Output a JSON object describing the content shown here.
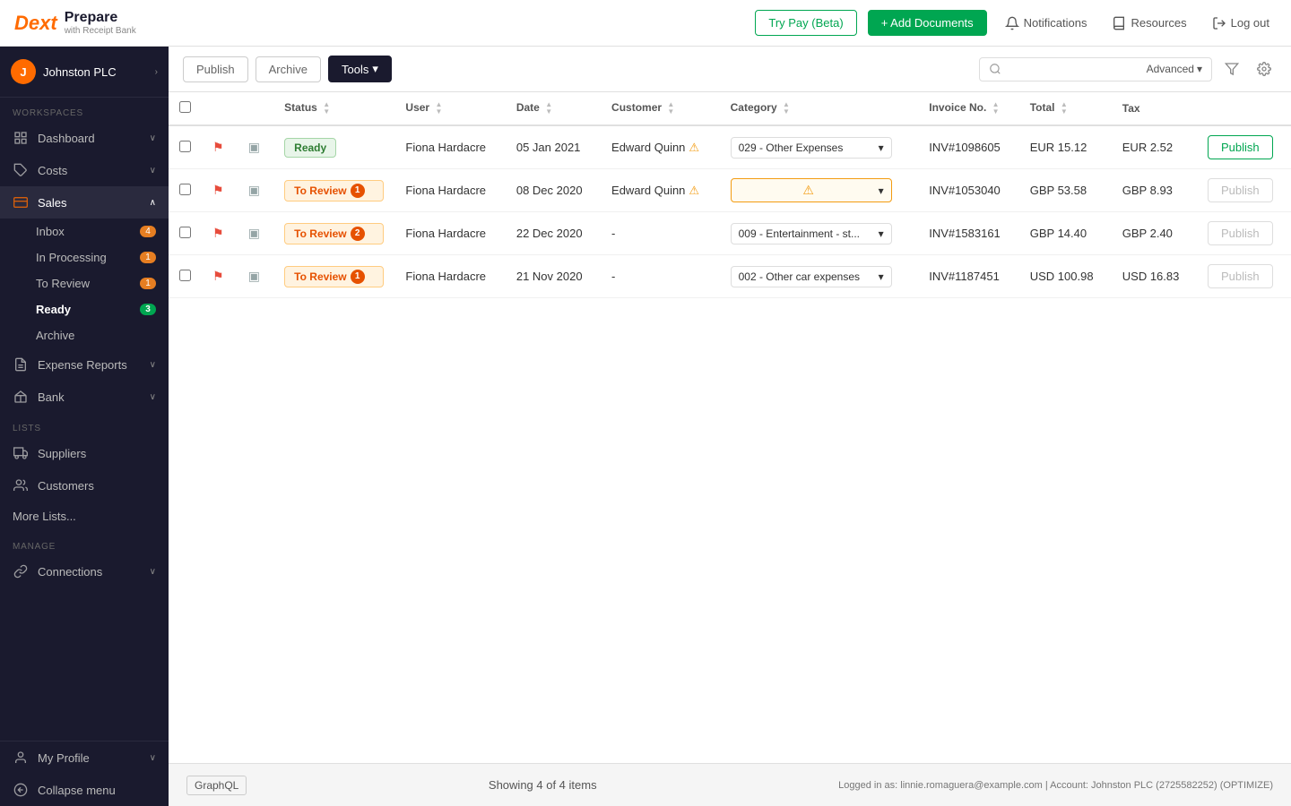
{
  "topbar": {
    "logo": "Dext",
    "product": "Prepare",
    "subtitle": "with Receipt Bank",
    "try_pay_label": "Try Pay (Beta)",
    "add_docs_label": "+ Add Documents",
    "notifications_label": "Notifications",
    "resources_label": "Resources",
    "logout_label": "Log out"
  },
  "sidebar": {
    "user": {
      "initials": "J",
      "name": "Johnston PLC"
    },
    "workspaces_label": "WORKSPACES",
    "items": [
      {
        "id": "dashboard",
        "label": "Dashboard",
        "icon": "grid"
      },
      {
        "id": "costs",
        "label": "Costs",
        "icon": "tag",
        "has_arrow": true
      },
      {
        "id": "sales",
        "label": "Sales",
        "icon": "credit-card",
        "has_arrow": true,
        "expanded": true
      },
      {
        "id": "expense-reports",
        "label": "Expense Reports",
        "icon": "file-text",
        "has_arrow": true
      },
      {
        "id": "bank",
        "label": "Bank",
        "icon": "bank",
        "has_arrow": true
      }
    ],
    "sales_sub": [
      {
        "id": "inbox",
        "label": "Inbox",
        "badge": "4"
      },
      {
        "id": "in-processing",
        "label": "In Processing",
        "badge": "1"
      },
      {
        "id": "to-review",
        "label": "To Review",
        "badge": "1"
      },
      {
        "id": "ready",
        "label": "Ready",
        "badge": "3"
      },
      {
        "id": "archive",
        "label": "Archive",
        "badge": ""
      }
    ],
    "lists_label": "LISTS",
    "list_items": [
      {
        "id": "suppliers",
        "label": "Suppliers",
        "icon": "truck"
      },
      {
        "id": "customers",
        "label": "Customers",
        "icon": "users"
      },
      {
        "id": "more-lists",
        "label": "More Lists...",
        "icon": ""
      }
    ],
    "manage_label": "MANAGE",
    "manage_items": [
      {
        "id": "connections",
        "label": "Connections",
        "icon": "link",
        "has_arrow": true
      },
      {
        "id": "my-profile",
        "label": "My Profile",
        "icon": "user",
        "has_arrow": true
      }
    ],
    "collapse_label": "Collapse menu"
  },
  "toolbar": {
    "publish_label": "Publish",
    "archive_label": "Archive",
    "tools_label": "Tools",
    "search_placeholder": "",
    "advanced_label": "Advanced"
  },
  "table": {
    "columns": [
      {
        "id": "status",
        "label": "Status"
      },
      {
        "id": "user",
        "label": "User"
      },
      {
        "id": "date",
        "label": "Date"
      },
      {
        "id": "customer",
        "label": "Customer"
      },
      {
        "id": "category",
        "label": "Category"
      },
      {
        "id": "invoice_no",
        "label": "Invoice No."
      },
      {
        "id": "total",
        "label": "Total"
      },
      {
        "id": "tax",
        "label": "Tax"
      }
    ],
    "rows": [
      {
        "id": "row1",
        "status": "Ready",
        "status_type": "ready",
        "user": "Fiona Hardacre",
        "date": "05 Jan 2021",
        "customer": "Edward Quinn",
        "customer_warn": true,
        "category": "029 - Other Expenses",
        "category_warn": false,
        "invoice_no": "INV#1098605",
        "total": "EUR 15.12",
        "tax": "EUR 2.52",
        "can_publish": true
      },
      {
        "id": "row2",
        "status": "To Review",
        "status_type": "review",
        "status_num": "1",
        "user": "Fiona Hardacre",
        "date": "08 Dec 2020",
        "customer": "Edward Quinn",
        "customer_warn": true,
        "category": "",
        "category_warn": true,
        "invoice_no": "INV#1053040",
        "total": "GBP 53.58",
        "tax": "GBP 8.93",
        "can_publish": false
      },
      {
        "id": "row3",
        "status": "To Review",
        "status_type": "review",
        "status_num": "2",
        "user": "Fiona Hardacre",
        "date": "22 Dec 2020",
        "customer": "-",
        "customer_warn": false,
        "category": "009 - Entertainment - st...",
        "category_warn": false,
        "invoice_no": "INV#1583161",
        "total": "GBP 14.40",
        "tax": "GBP 2.40",
        "can_publish": false
      },
      {
        "id": "row4",
        "status": "To Review",
        "status_type": "review",
        "status_num": "1",
        "user": "Fiona Hardacre",
        "date": "21 Nov 2020",
        "customer": "-",
        "customer_warn": false,
        "category": "002 - Other car expenses",
        "category_warn": false,
        "invoice_no": "INV#1187451",
        "total": "USD 100.98",
        "tax": "USD 16.83",
        "can_publish": false
      }
    ]
  },
  "footer": {
    "showing_text": "Showing 4 of 4 items",
    "graphql_label": "GraphQL",
    "logged_in_text": "Logged in as: linnie.romaguera@example.com | Account: Johnston PLC (2725582252) (OPTIMIZE)"
  }
}
